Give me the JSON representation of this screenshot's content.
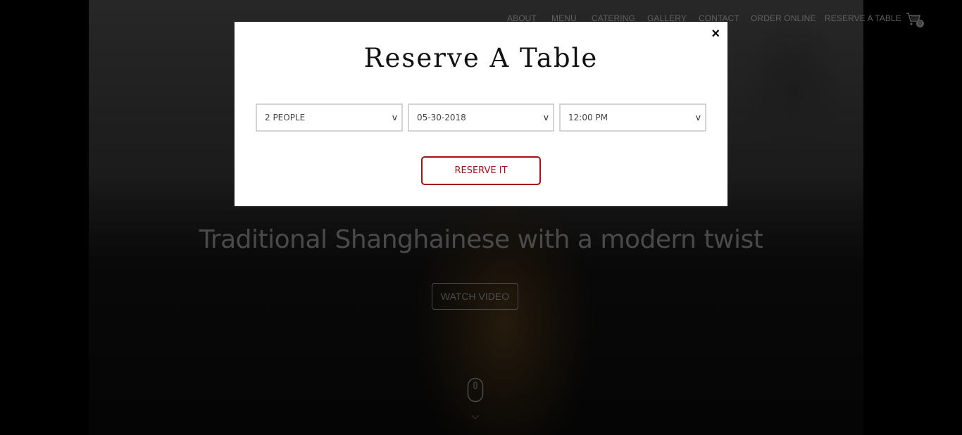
{
  "nav": {
    "items": [
      "ABOUT",
      "MENU",
      "CATERING",
      "GALLERY",
      "CONTACT",
      "ORDER ONLINE",
      "RESERVE A TABLE"
    ],
    "cart_count": "0"
  },
  "hero": {
    "tagline": "Traditional Shanghainese with a modern twist",
    "watch_video": "WATCH VIDEO"
  },
  "modal": {
    "title": "Reserve A Table",
    "close": "×",
    "party_size": "2 PEOPLE",
    "date": "05-30-2018",
    "time": "12:00 PM",
    "select_arrow": "v",
    "reserve_button": "RESERVE IT"
  }
}
